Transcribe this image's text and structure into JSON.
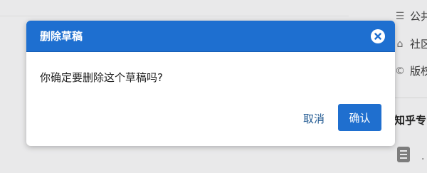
{
  "background": {
    "sidebar_items": [
      {
        "icon": "list-icon",
        "label": "公共"
      },
      {
        "icon": "home-icon",
        "label": "社区"
      },
      {
        "icon": "copyright-icon",
        "label": "版权"
      }
    ],
    "heading": "知乎专",
    "doc_bullet": "·"
  },
  "dialog": {
    "title": "删除草稿",
    "message": "你确定要删除这个草稿吗?",
    "cancel_label": "取消",
    "confirm_label": "确认"
  },
  "colors": {
    "header": "#1e6fd0",
    "confirm": "#1f6fcf",
    "cancel_text": "#225a92"
  }
}
